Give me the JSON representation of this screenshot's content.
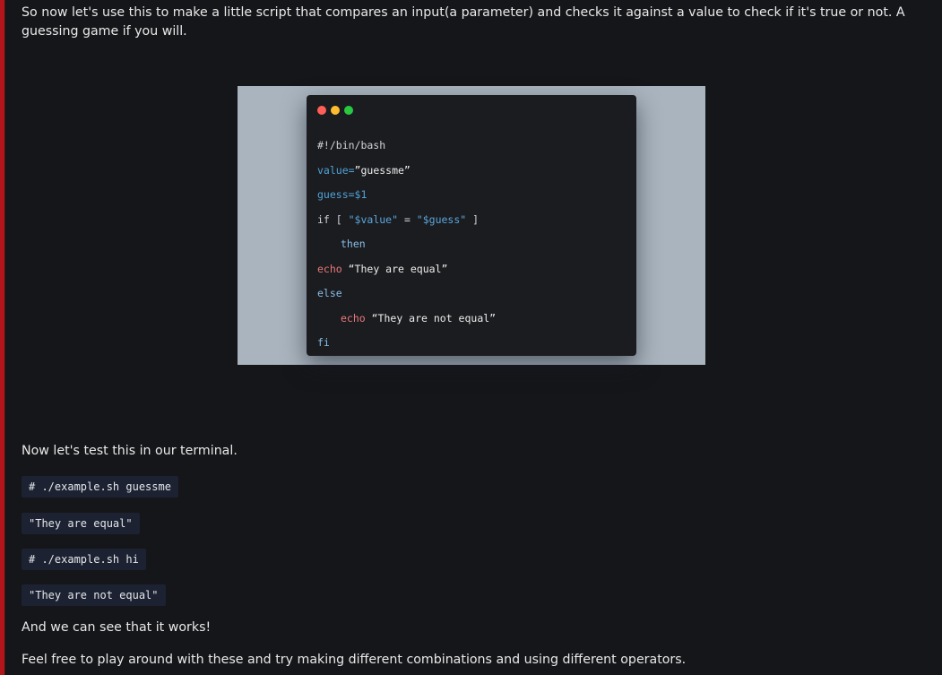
{
  "article": {
    "intro": "So now let's use this to make a little script that compares an input(a parameter) and checks it against a value to check if it's true or not. A guessing game if you will.",
    "code_image": {
      "traffic_colors": {
        "red": "#fe5f57",
        "yellow": "#febc2e",
        "green": "#28c840"
      },
      "lines": {
        "shebang": "#!/bin/bash",
        "value_var": "value=",
        "value_val": "”guessme”",
        "guess_var": "guess=$1",
        "if_open": "if [ ",
        "if_left": "\"$value\"",
        "if_op": " = ",
        "if_right": "\"$guess\"",
        "if_close": " ]",
        "then": "then",
        "echo1_kw": "echo",
        "echo1_str": " “They are equal”",
        "else": "else",
        "echo2_kw": "echo",
        "echo2_str": " “They are not equal”",
        "fi": "fi"
      }
    },
    "test_intro": "Now let's test this in our terminal.",
    "terminal": {
      "cmd1": "# ./example.sh guessme",
      "out1": "\"They are equal\"",
      "cmd2": "# ./example.sh hi",
      "out2": "\"They are not equal\""
    },
    "works": "And we can see that it works!",
    "outro": "Feel free to play around with these and try making different combinations and using different operators."
  }
}
